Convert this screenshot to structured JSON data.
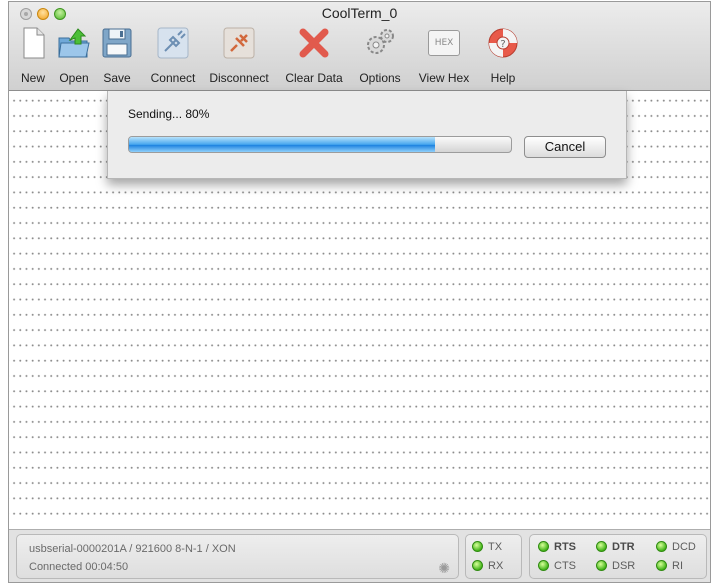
{
  "window": {
    "title": "CoolTerm_0"
  },
  "toolbar": {
    "new_label": "New",
    "open_label": "Open",
    "save_label": "Save",
    "connect_label": "Connect",
    "disconnect_label": "Disconnect",
    "clear_label": "Clear Data",
    "options_label": "Options",
    "hex_label": "View Hex",
    "hex_badge": "HEX",
    "help_label": "Help"
  },
  "icons": {
    "new": "new-document-icon",
    "open": "open-folder-icon",
    "save": "floppy-disk-icon",
    "connect": "connect-plug-icon",
    "disconnect": "disconnect-plug-icon",
    "clear": "red-x-icon",
    "options": "gears-icon",
    "hex": "hex-icon",
    "help": "lifebuoy-icon"
  },
  "sending": {
    "text": "Sending... 80%",
    "progress": 0.8,
    "cancel_label": "Cancel"
  },
  "status": {
    "port_info": "usbserial-0000201A / 921600 8-N-1 / XON",
    "connection": "Connected 00:04:50"
  },
  "lights": {
    "tx": "TX",
    "rx": "RX",
    "rts": "RTS",
    "cts": "CTS",
    "dtr": "DTR",
    "dsr": "DSR",
    "dcd": "DCD",
    "ri": "RI"
  },
  "colors": {
    "progress_blue": "#1e83e0",
    "led_green": "#44b51a"
  }
}
